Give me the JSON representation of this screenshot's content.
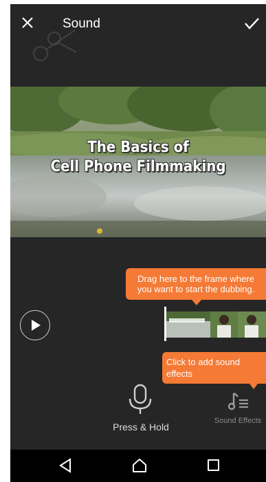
{
  "header": {
    "title": "Sound",
    "close_icon": "close-icon",
    "confirm_icon": "checkmark-icon"
  },
  "video": {
    "title_line1": "The Basics of",
    "title_line2": "Cell Phone Filmmaking"
  },
  "tooltips": {
    "drag": "Drag  here to the frame where you want to start the dubbing.",
    "sound_effects": "Click to add sound effects"
  },
  "controls": {
    "play_icon": "play-icon",
    "mic_icon": "microphone-icon",
    "press_hold_label": "Press & Hold",
    "sound_effects_icon": "music-note-list-icon",
    "sound_effects_label": "Sound Effects"
  },
  "navbar": {
    "back_icon": "back-triangle-icon",
    "home_icon": "home-icon",
    "recent_icon": "recent-apps-icon"
  },
  "colors": {
    "background": "#262626",
    "accent_orange": "#f47a35",
    "navbar": "#000000"
  }
}
